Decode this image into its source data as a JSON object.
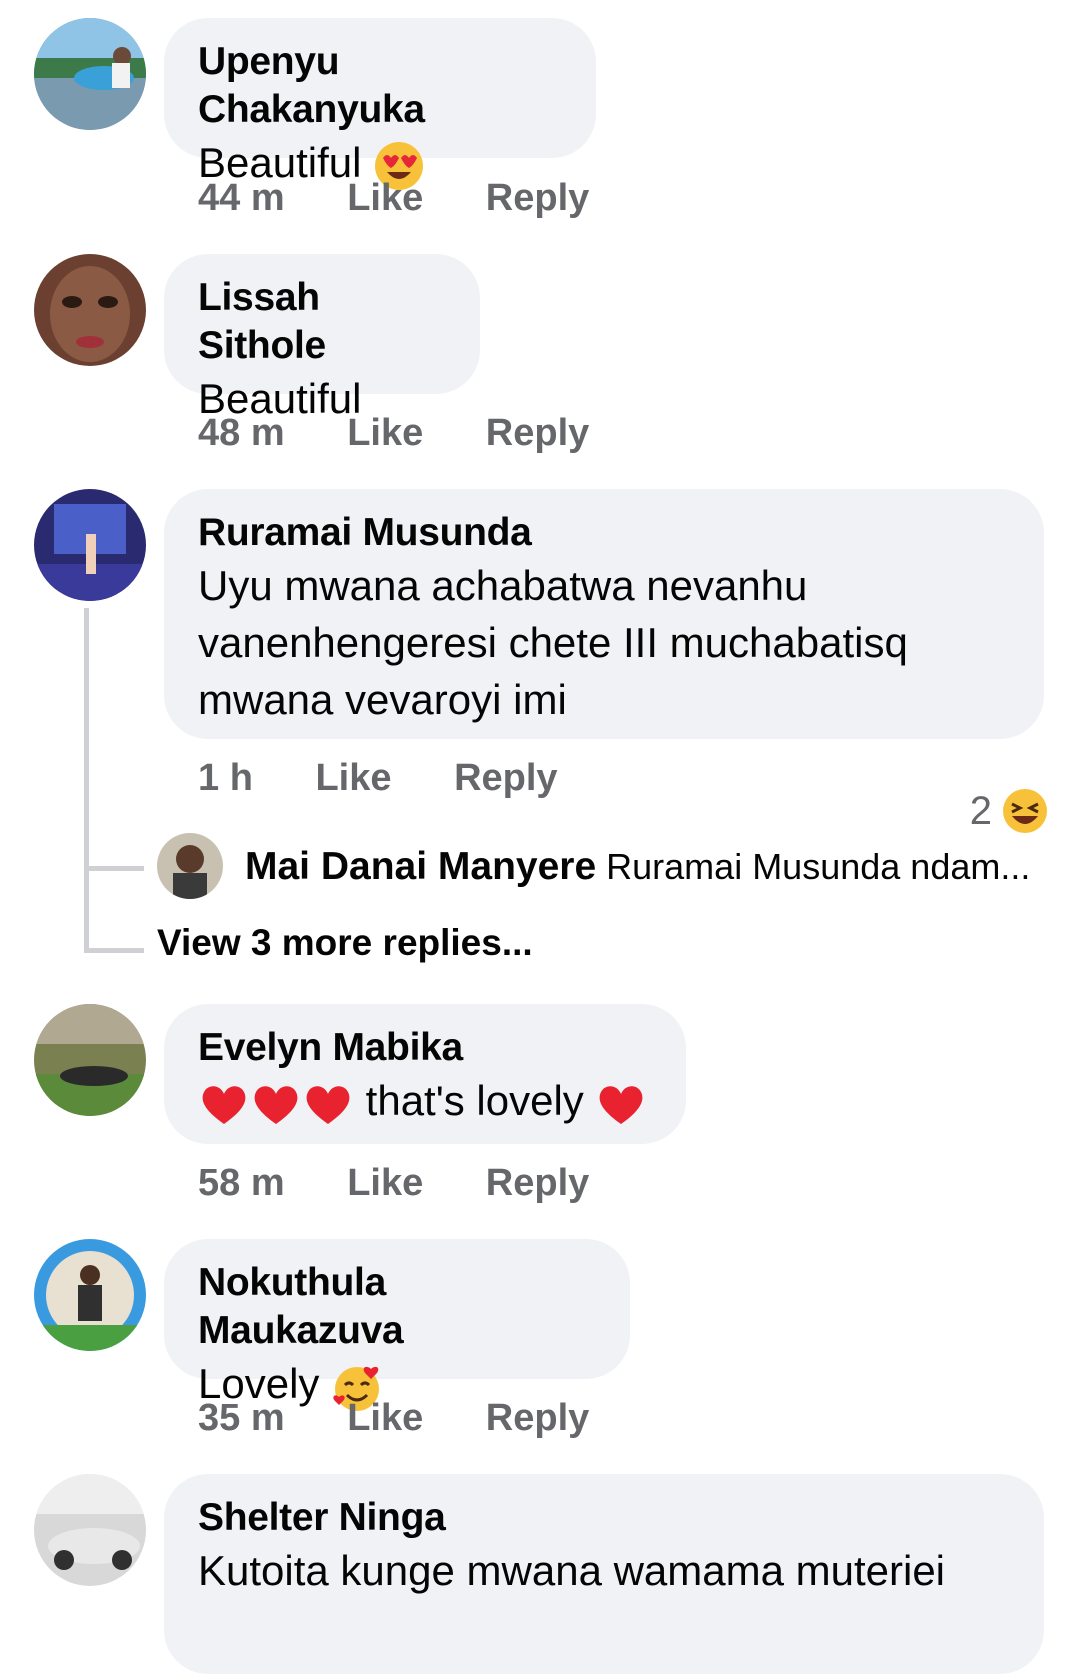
{
  "comments": [
    {
      "author": "Upenyu Chakanyuka",
      "text": "Beautiful",
      "time": "44 m",
      "like": "Like",
      "reply": "Reply",
      "emoji": "heart-eyes"
    },
    {
      "author": "Lissah Sithole",
      "text": "Beautiful",
      "time": "48 m",
      "like": "Like",
      "reply": "Reply"
    },
    {
      "author": "Ruramai Musunda",
      "lines": [
        "Uyu mwana achabatwa nevanhu",
        "vanenhengeresi chete III muchabatisq",
        "mwana vevaroyi imi"
      ],
      "time": "1 h",
      "like": "Like",
      "reply": "Reply",
      "reaction_count": "2",
      "reaction": "laughing"
    },
    {
      "author": "Evelyn Mabika",
      "text": "that's lovely",
      "time": "58 m",
      "like": "Like",
      "reply": "Reply"
    },
    {
      "author": "Nokuthula Maukazuva",
      "text": "Lovely",
      "time": "35 m",
      "like": "Like",
      "reply": "Reply",
      "emoji": "smiling-hearts"
    },
    {
      "author": "Shelter Ninga",
      "text": "Kutoita kunge mwana wamama muteriei"
    }
  ],
  "reply_preview": {
    "author": "Mai Danai Manyere",
    "text": "Ruramai Musunda ndam..."
  },
  "view_more": "View 3 more replies...",
  "colors": {
    "bubble": "#f0f2f5",
    "meta": "#65676b",
    "text": "#050505",
    "thread": "#ced0d4"
  }
}
